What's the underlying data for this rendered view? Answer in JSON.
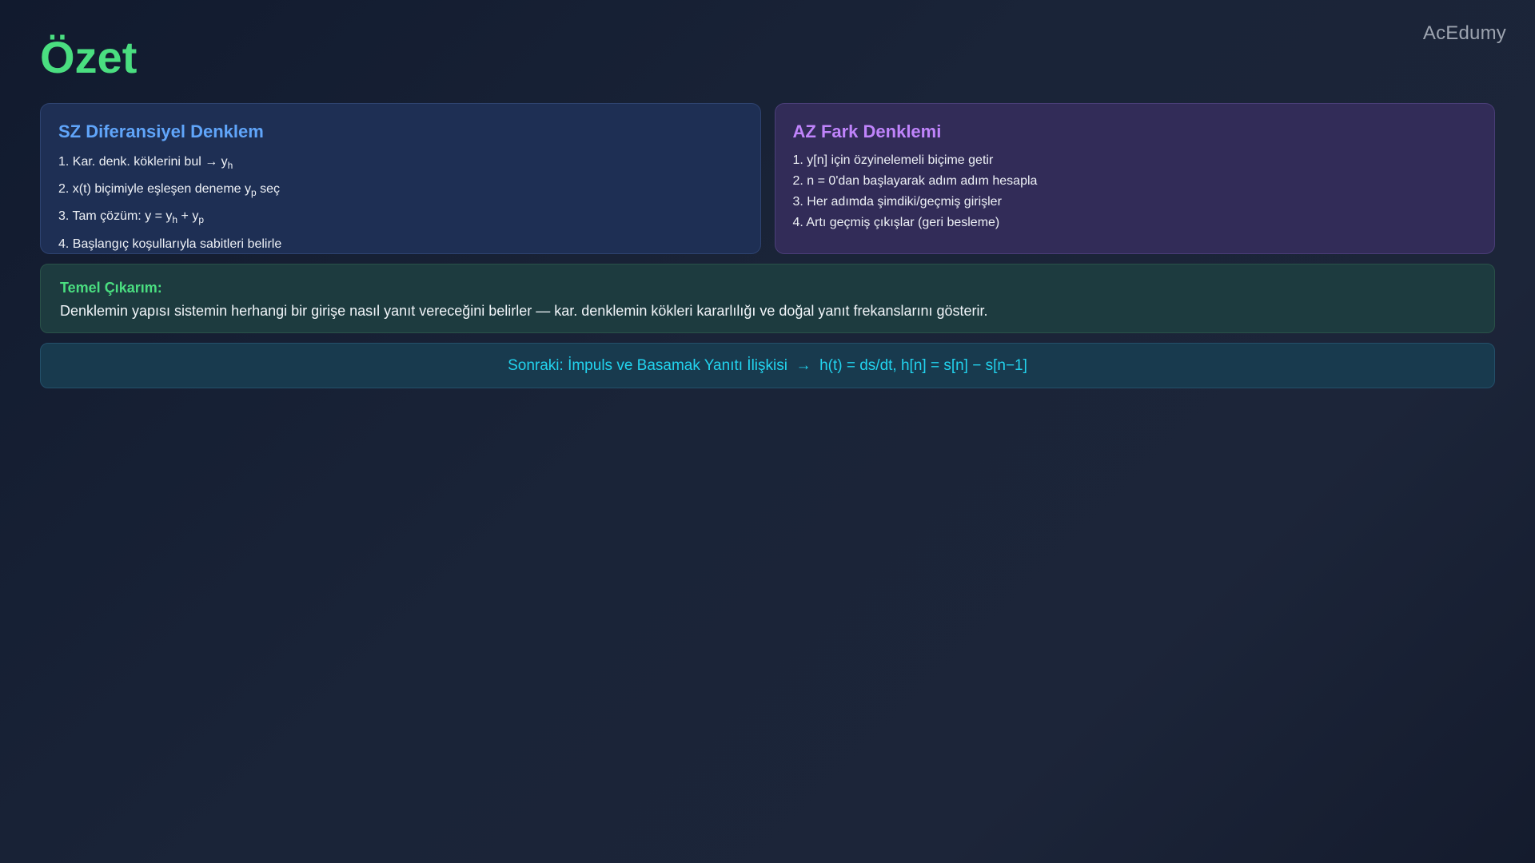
{
  "brand": "AcEdumy",
  "title": "Özet",
  "left_card": {
    "title": "SZ Diferansiyel Denklem",
    "steps": [
      {
        "text": "1. Kar. denk. köklerini bul → y",
        "sub": "h",
        "after": ""
      },
      {
        "text": "2. x(t) biçimiyle eşleşen deneme y",
        "sub": "p",
        "after": " seç"
      },
      {
        "text": "3. Tam çözüm: y = y",
        "sub": "h",
        "mid": " + y",
        "sub2": "p"
      },
      {
        "text": "4. Başlangıç koşullarıyla sabitleri belirle"
      }
    ]
  },
  "right_card": {
    "title": "AZ Fark Denklemi",
    "steps": [
      "1. y[n] için özyinelemeli biçime getir",
      "2. n = 0'dan başlayarak adım adım hesapla",
      "3. Her adımda şimdiki/geçmiş girişler",
      "4. Artı geçmiş çıkışlar (geri besleme)"
    ]
  },
  "takeaway": {
    "label": "Temel Çıkarım:",
    "text": "Denklemin yapısı sistemin herhangi bir girişe nasıl yanıt vereceğini belirler — kar. denklemin kökleri kararlılığı ve doğal yanıt frekanslarını gösterir."
  },
  "next": {
    "text": "Sonraki: İmpuls ve Basamak Yanıtı İlişkisi  →  h(t) = ds/dt, h[n] = s[n] − s[n−1]"
  }
}
